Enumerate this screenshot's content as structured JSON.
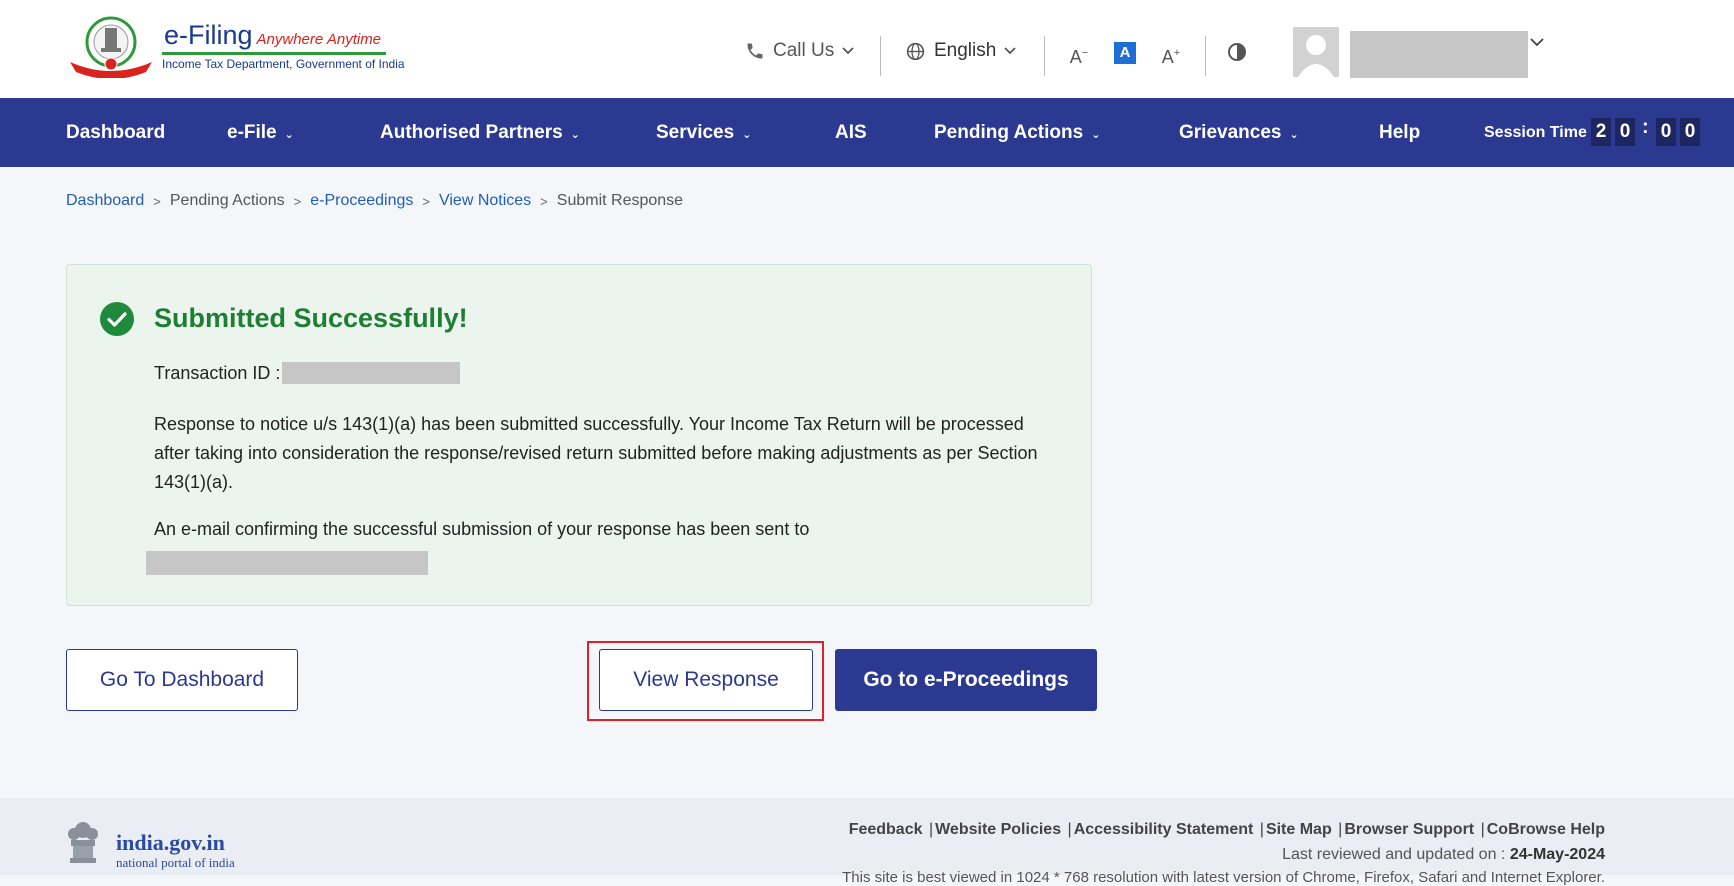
{
  "header": {
    "logo_title": "e-Filing",
    "logo_tagline": "Anywhere Anytime",
    "logo_subtitle": "Income Tax Department, Government of India",
    "call_us": "Call Us",
    "language": "English",
    "font_decrease": "A-",
    "font_default": "A",
    "font_increase": "A+"
  },
  "nav": {
    "items": [
      {
        "label": "Dashboard"
      },
      {
        "label": "e-File"
      },
      {
        "label": "Authorised Partners"
      },
      {
        "label": "Services"
      },
      {
        "label": "AIS"
      },
      {
        "label": "Pending Actions"
      },
      {
        "label": "Grievances"
      },
      {
        "label": "Help"
      }
    ],
    "session_label": "Session Time",
    "session_digits": [
      "2",
      "0",
      "0",
      "0"
    ],
    "session_colon": ":"
  },
  "breadcrumb": {
    "items": [
      "Dashboard",
      "Pending Actions",
      "e-Proceedings",
      "View Notices",
      "Submit Response"
    ]
  },
  "success": {
    "title": "Submitted Successfully!",
    "txn_label": "Transaction ID :",
    "message": "Response to notice u/s 143(1)(a) has been submitted successfully. Your Income Tax Return will be processed after taking into consideration the response/revised return submitted before making adjustments as per Section 143(1)(a).",
    "email_note": "An e-mail confirming the successful submission of your response has been sent to"
  },
  "actions": {
    "dashboard_label": "Go To Dashboard",
    "view_response_label": "View Response",
    "proceedings_label": "Go to e-Proceedings"
  },
  "footer": {
    "portal_title": "india.gov.in",
    "portal_subtitle": "national portal of india",
    "links": [
      "Feedback",
      "Website Policies",
      "Accessibility Statement",
      "Site Map",
      "Browser Support",
      "CoBrowse Help"
    ],
    "updated_label": "Last reviewed and updated on :",
    "updated_date": "24-May-2024",
    "cut_text": "This site is best viewed in 1024 * 768 resolution with latest version of Chrome, Firefox, Safari and Internet Explorer."
  },
  "colors": {
    "nav_bg": "#2b3990",
    "success_green": "#1e7e34",
    "link_blue": "#1e5fb8",
    "highlight_red": "#e0202a"
  }
}
